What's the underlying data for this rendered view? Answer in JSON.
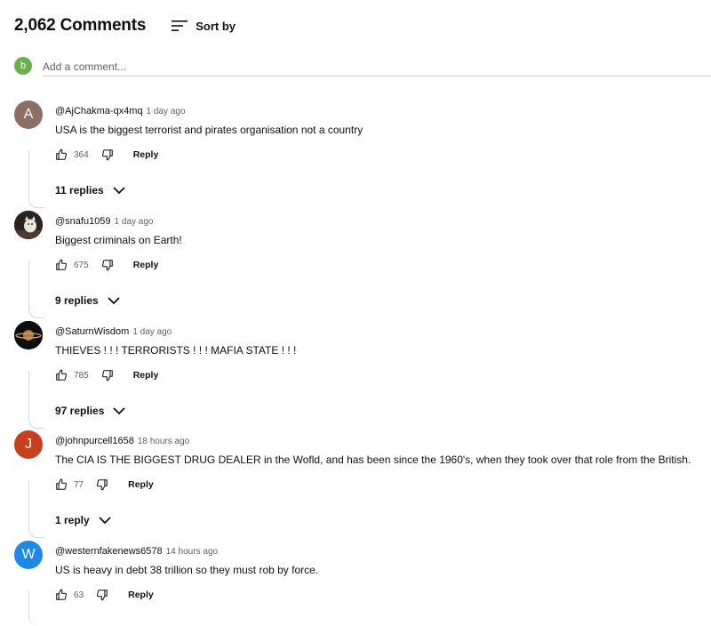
{
  "header": {
    "count": "2,062 Comments",
    "sort_label": "Sort by"
  },
  "add_comment": {
    "avatar_letter": "b",
    "placeholder": "Add a comment..."
  },
  "comments": [
    {
      "avatar_letter": "A",
      "avatar_color": "#8d6e63",
      "handle": "@AjChakma-qx4mq",
      "time": "1 day ago",
      "text": "USA is the biggest terrorist and pirates organisation not a country",
      "likes": "364",
      "reply_label": "Reply",
      "replies": "11 replies"
    },
    {
      "avatar_letter": "",
      "avatar_color": "#2b2320",
      "handle": "@snafu1059",
      "time": "1 day ago",
      "text": "Biggest criminals on Earth!",
      "likes": "675",
      "reply_label": "Reply",
      "replies": "9 replies"
    },
    {
      "avatar_letter": "",
      "avatar_color": "#111111",
      "handle": "@SaturnWisdom",
      "time": "1 day ago",
      "text": "THIEVES ! ! !  TERRORISTS ! ! ! MAFIA STATE ! ! !",
      "likes": "785",
      "reply_label": "Reply",
      "replies": "97 replies"
    },
    {
      "avatar_letter": "J",
      "avatar_color": "#c6401d",
      "handle": "@johnpurcell1658",
      "time": "18 hours ago",
      "text": "The CIA IS THE BIGGEST DRUG DEALER in the Wofld, and has been since the 1960's, when they took over that role from the British.",
      "likes": "77",
      "reply_label": "Reply",
      "replies": "1 reply"
    },
    {
      "avatar_letter": "W",
      "avatar_color": "#1e88e5",
      "handle": "@westernfakenews6578",
      "time": "14 hours ago",
      "text": "US is heavy in debt 38 trillion so they must rob by force.",
      "likes": "63",
      "reply_label": "Reply",
      "replies": ""
    }
  ]
}
